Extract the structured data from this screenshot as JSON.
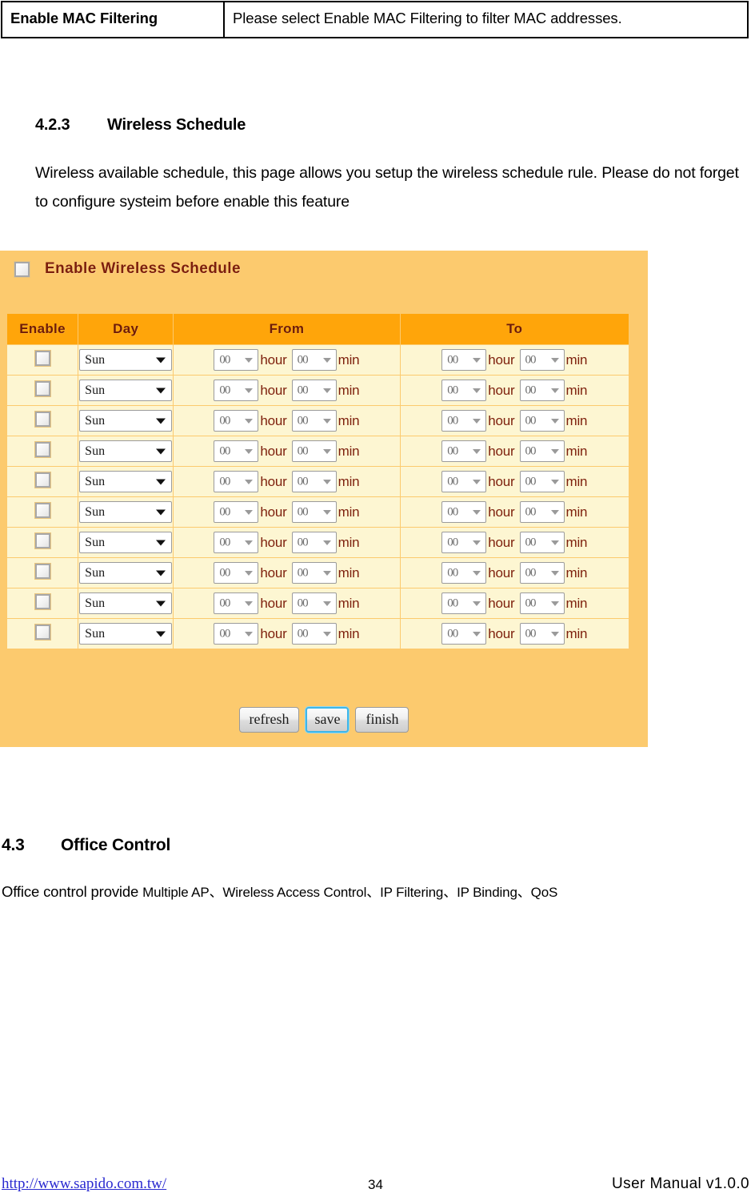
{
  "spec_table": {
    "rows": [
      {
        "label": "Enable MAC Filtering",
        "description": "Please select Enable MAC Filtering to filter MAC addresses."
      }
    ]
  },
  "sections": [
    {
      "number": "4.2.3",
      "title": "Wireless Schedule",
      "body": "Wireless available schedule, this page allows you setup the wireless schedule rule. Please do not forget to configure systeim before enable this feature"
    },
    {
      "number": "4.3",
      "title": "Office Control",
      "body_lead": "Office control provide ",
      "body_list": "Multiple AP、Wireless Access Control、IP Filtering、IP Binding、QoS"
    }
  ],
  "screenshot": {
    "enable_checkbox_label": "Enable Wireless Schedule",
    "enable_checkbox_checked": false,
    "colors": {
      "panel_background": "#fcca6e",
      "header_background": "#ffa50a",
      "row_background": "#fdf6d2",
      "header_text": "#6e1c08",
      "label_text": "#7d1f0c",
      "focus_ring": "#3fb6e8"
    },
    "table": {
      "columns": [
        "Enable",
        "Day",
        "From",
        "To"
      ],
      "unit_hour": "hour",
      "unit_min": "min",
      "rows": [
        {
          "enabled": false,
          "day": "Sun",
          "from_hour": "00",
          "from_min": "00",
          "to_hour": "00",
          "to_min": "00"
        },
        {
          "enabled": false,
          "day": "Sun",
          "from_hour": "00",
          "from_min": "00",
          "to_hour": "00",
          "to_min": "00"
        },
        {
          "enabled": false,
          "day": "Sun",
          "from_hour": "00",
          "from_min": "00",
          "to_hour": "00",
          "to_min": "00"
        },
        {
          "enabled": false,
          "day": "Sun",
          "from_hour": "00",
          "from_min": "00",
          "to_hour": "00",
          "to_min": "00"
        },
        {
          "enabled": false,
          "day": "Sun",
          "from_hour": "00",
          "from_min": "00",
          "to_hour": "00",
          "to_min": "00"
        },
        {
          "enabled": false,
          "day": "Sun",
          "from_hour": "00",
          "from_min": "00",
          "to_hour": "00",
          "to_min": "00"
        },
        {
          "enabled": false,
          "day": "Sun",
          "from_hour": "00",
          "from_min": "00",
          "to_hour": "00",
          "to_min": "00"
        },
        {
          "enabled": false,
          "day": "Sun",
          "from_hour": "00",
          "from_min": "00",
          "to_hour": "00",
          "to_min": "00"
        },
        {
          "enabled": false,
          "day": "Sun",
          "from_hour": "00",
          "from_min": "00",
          "to_hour": "00",
          "to_min": "00"
        },
        {
          "enabled": false,
          "day": "Sun",
          "from_hour": "00",
          "from_min": "00",
          "to_hour": "00",
          "to_min": "00"
        }
      ]
    },
    "buttons": [
      {
        "label": "refresh",
        "focused": false
      },
      {
        "label": "save",
        "focused": true
      },
      {
        "label": "finish",
        "focused": false
      }
    ]
  },
  "footer": {
    "url": "http://www.sapido.com.tw/",
    "page_number": "34",
    "manual": "User Manual v1.0.0"
  }
}
